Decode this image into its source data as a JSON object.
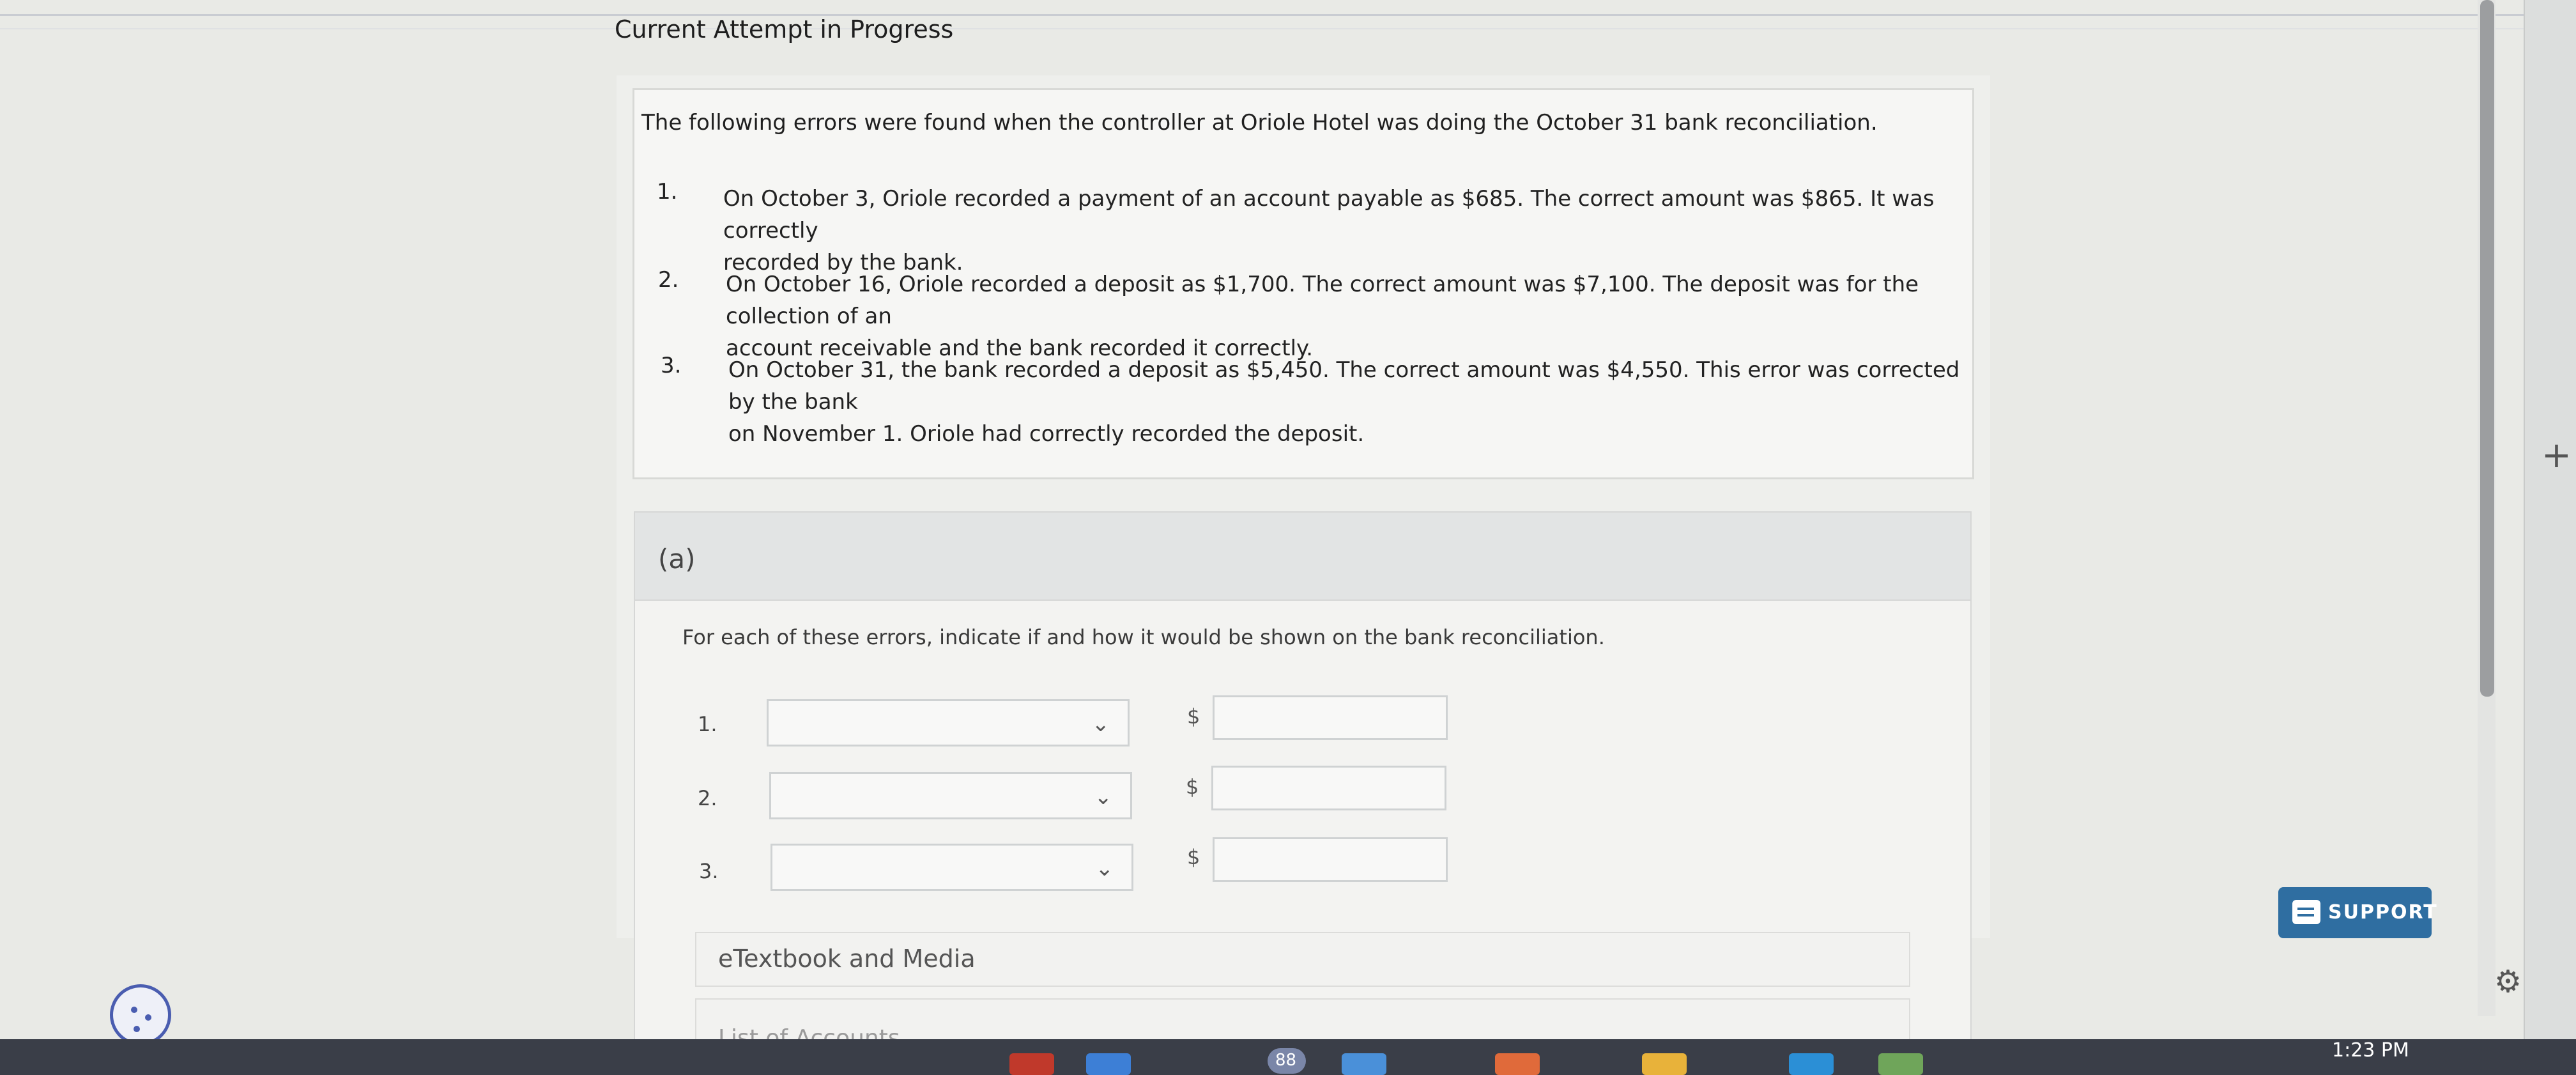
{
  "header": {
    "title": "Current Attempt in Progress"
  },
  "problem": {
    "intro": "The following errors were found when the controller at Oriole Hotel was doing the October 31 bank reconciliation.",
    "items": [
      {
        "number": "1.",
        "line1": "On October 3, Oriole recorded a payment of an account payable as $685. The correct amount was $865. It was correctly",
        "line2": "recorded by the bank."
      },
      {
        "number": "2.",
        "line1": "On October 16, Oriole recorded a deposit as $1,700. The correct amount was $7,100. The deposit was for the collection of an",
        "line2": "account receivable and the bank recorded it correctly."
      },
      {
        "number": "3.",
        "line1": "On October 31, the bank recorded a deposit as $5,450. The correct amount was $4,550. This error was corrected by the bank",
        "line2": "on November 1. Oriole had correctly recorded the deposit."
      }
    ]
  },
  "part_a": {
    "label": "(a)",
    "instruction": "For each of these errors, indicate if and how it would be shown on the bank reconciliation.",
    "rows": [
      {
        "number": "1.",
        "currency": "$",
        "selected": "",
        "amount": ""
      },
      {
        "number": "2.",
        "currency": "$",
        "selected": "",
        "amount": ""
      },
      {
        "number": "3.",
        "currency": "$",
        "selected": "",
        "amount": ""
      }
    ]
  },
  "resources": {
    "ebook": "eTextbook and Media",
    "accounts": "List of Accounts"
  },
  "support": {
    "label": "SUPPORT"
  },
  "taskbar": {
    "time": "1:23 PM",
    "badge": "88"
  },
  "colors": {
    "support": "#2f6ea1",
    "taskbar": "#3a3e48"
  }
}
